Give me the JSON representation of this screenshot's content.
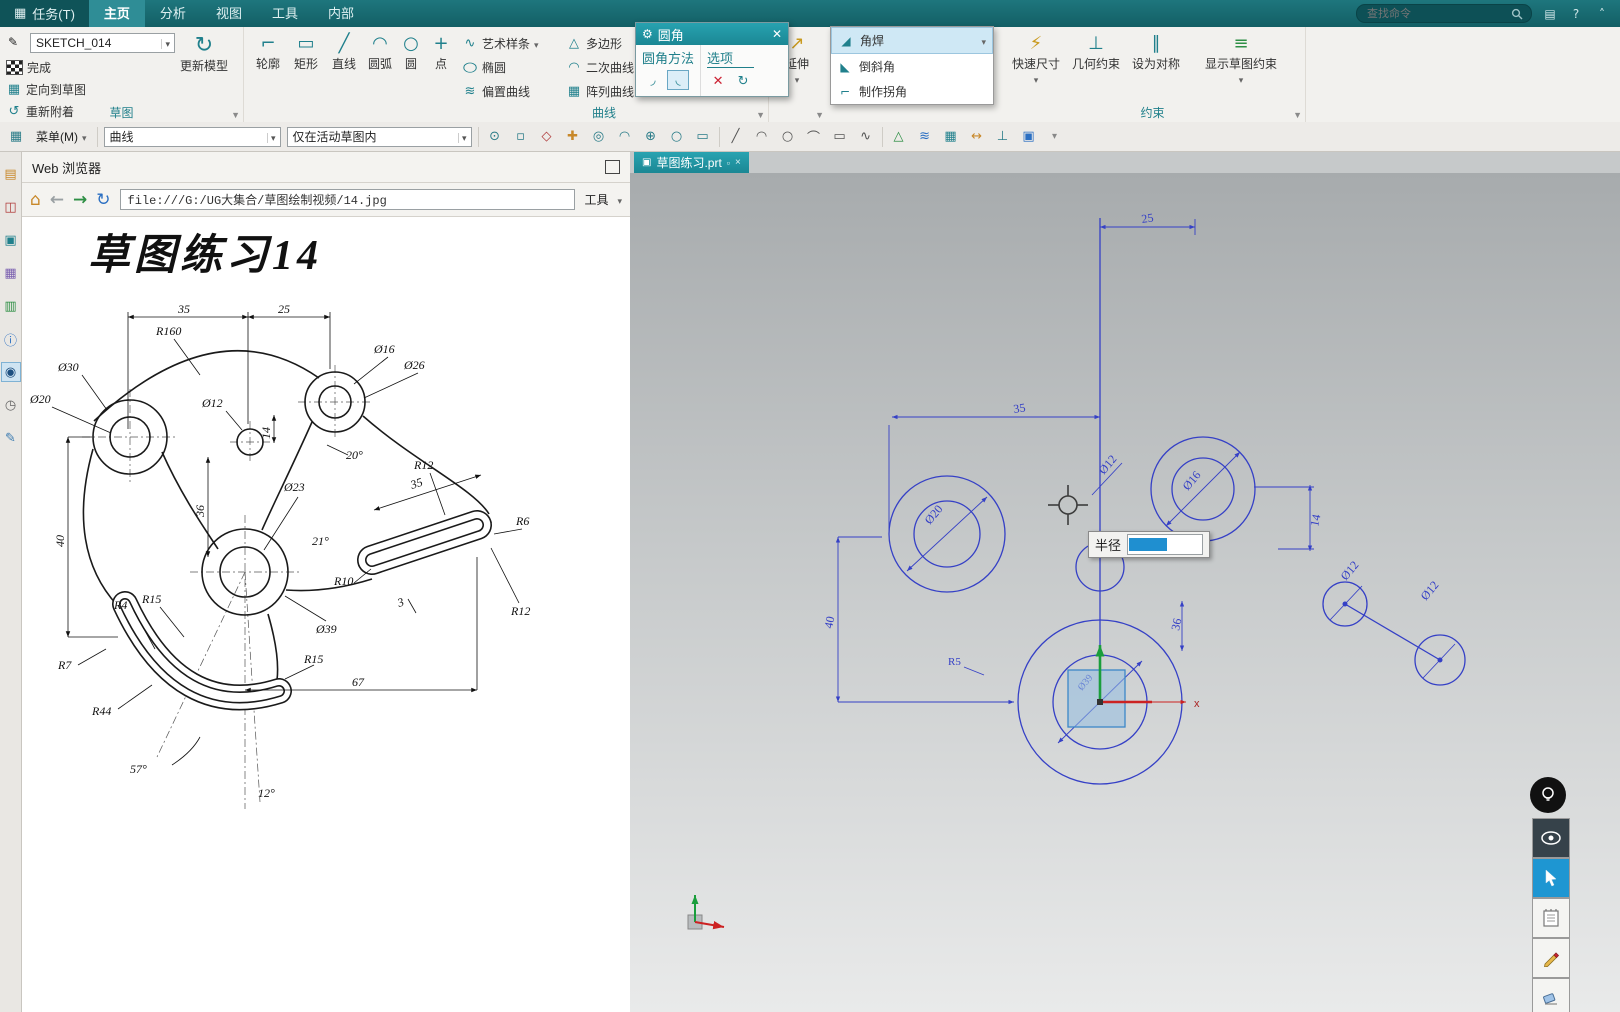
{
  "titlebar": {
    "tabs": [
      "任务(T)",
      "主页",
      "分析",
      "视图",
      "工具",
      "内部"
    ],
    "search_placeholder": "查找命令",
    "win_icons": [
      {
        "name": "ribbon-options-icon",
        "glyph": "▤"
      },
      {
        "name": "help-icon",
        "glyph": "?"
      },
      {
        "name": "minimize-ribbon-icon",
        "glyph": "˄"
      }
    ],
    "task_icon": "▦"
  },
  "ribbon": {
    "sketch": {
      "label": "草图",
      "sketch_name": "SKETCH_014",
      "finish": "完成",
      "orient": "定向到草图",
      "reattach": "重新附着",
      "update": "更新模型",
      "orient_glyph": "▦",
      "reattach_glyph": "↺",
      "update_glyph": "↻",
      "combo_glyph": "✎"
    },
    "curve": {
      "label": "曲线",
      "tools": [
        "轮廓",
        "矩形",
        "直线",
        "圆弧",
        "圆",
        "点"
      ],
      "tool_glyphs": [
        "⌐",
        "▭",
        "╱",
        "◠",
        "○",
        "+"
      ],
      "list_a": [
        "艺术样条",
        "椭圆",
        "偏置曲线"
      ],
      "list_a_glyphs": [
        "∿",
        "○",
        "≋"
      ],
      "list_b": [
        "多边形",
        "二次曲线",
        "阵列曲线"
      ],
      "list_b_glyphs": [
        "△",
        "◠",
        "▦"
      ]
    },
    "extend": "延伸",
    "extend_glyph": "↗",
    "corner_menu": [
      "角焊",
      "倒斜角",
      "制作拐角"
    ],
    "corner_glyphs": [
      "◢",
      "◣",
      "⌐"
    ],
    "constraint": {
      "label": "约束",
      "tools": [
        "快速尺寸",
        "几何约束",
        "设为对称",
        "显示草图约束"
      ],
      "glyphs": [
        "⚡",
        "⊥",
        "∥",
        "≡"
      ]
    }
  },
  "fillet_dialog": {
    "title": "圆角",
    "method": "圆角方法",
    "options": "选项",
    "gear_glyph": "⚙",
    "icons": [
      {
        "name": "fillet-trim-icon",
        "glyph": "◞"
      },
      {
        "name": "fillet-no-trim-icon",
        "glyph": "◟"
      },
      {
        "name": "delete-third-curve-icon",
        "glyph": "✕"
      },
      {
        "name": "alternate-fillet-icon",
        "glyph": "↻"
      }
    ]
  },
  "toolbar": {
    "menu": "菜单(M)",
    "menu_icon": "▦",
    "type_filter": "曲线",
    "scope_filter": "仅在活动草图内",
    "icons": [
      {
        "name": "snap-point-icon",
        "glyph": "⊙"
      },
      {
        "name": "endpoint-snap-icon",
        "glyph": "▫"
      },
      {
        "name": "midpoint-snap-icon",
        "glyph": "◇"
      },
      {
        "name": "intersection-snap-icon",
        "glyph": "✚"
      },
      {
        "name": "center-snap-icon",
        "glyph": "◎"
      },
      {
        "name": "quadrant-snap-icon",
        "glyph": "◠"
      },
      {
        "name": "existing-point-snap-icon",
        "glyph": "⊕"
      },
      {
        "name": "point-on-curve-snap-icon",
        "glyph": "○"
      },
      {
        "name": "point-on-surface-snap-icon",
        "glyph": "▭"
      },
      {
        "name": "line-tool-icon",
        "glyph": "╱"
      },
      {
        "name": "arc-tool-icon",
        "glyph": "◠"
      },
      {
        "name": "circle-tool-icon",
        "glyph": "○"
      },
      {
        "name": "fillet-tool-icon",
        "glyph": "⌒"
      },
      {
        "name": "rectangle-tool-icon",
        "glyph": "▭"
      },
      {
        "name": "spline-tool-icon",
        "glyph": "∿"
      },
      {
        "name": "polygon-tool-icon",
        "glyph": "△"
      },
      {
        "name": "offset-curve-tool-icon",
        "glyph": "≋"
      },
      {
        "name": "pattern-curve-tool-icon",
        "glyph": "▦"
      },
      {
        "name": "quick-dimension-tool-icon",
        "glyph": "↔"
      },
      {
        "name": "geometric-constraint-tool-icon",
        "glyph": "⊥"
      },
      {
        "name": "display-constraint-tool-icon",
        "glyph": "▣"
      },
      {
        "name": "more-tools-icon",
        "glyph": "▾"
      }
    ]
  },
  "resource_bar": {
    "icons": [
      {
        "name": "bookmark-navigator-icon",
        "glyph": "▤"
      },
      {
        "name": "constraint-navigator-icon",
        "glyph": "◫"
      },
      {
        "name": "part-navigator-icon",
        "glyph": "▣"
      },
      {
        "name": "reuse-library-icon",
        "glyph": "▦"
      },
      {
        "name": "materials-library-icon",
        "glyph": "▥"
      },
      {
        "name": "info-icon",
        "glyph": "ⓘ"
      },
      {
        "name": "web-browser-icon",
        "glyph": "◉"
      },
      {
        "name": "history-icon",
        "glyph": "◷"
      },
      {
        "name": "roles-icon",
        "glyph": "✎"
      }
    ]
  },
  "browser": {
    "title": "Web 浏览器",
    "address": "file:///G:/UG大集合/草图绘制视频/14.jpg",
    "tools": "工具",
    "drawing_title": "草图练习14",
    "home_glyph": "⌂",
    "back_glyph": "←",
    "fwd_glyph": "→",
    "refresh_glyph": "↻"
  },
  "drawing_dims": [
    "35",
    "25",
    "R160",
    "Ø30",
    "Ø20",
    "Ø16",
    "Ø26",
    "Ø12",
    "14",
    "20°",
    "36",
    "40",
    "Ø23",
    "Ø39",
    "21°",
    "35",
    "R12",
    "R6",
    "R12",
    "R10",
    "3",
    "R15",
    "R4",
    "R7",
    "R44",
    "R15",
    "67",
    "57°",
    "12°"
  ],
  "viewport": {
    "tab": "草图练习.prt",
    "tab_icon": "▣",
    "radius_label": "半径",
    "axis_x": "x",
    "dims": [
      "25",
      "35",
      "40",
      "Ø20",
      "Ø16",
      "Ø12",
      "14",
      "Ø39",
      "36",
      "R5",
      "Ø12",
      "Ø12"
    ]
  }
}
